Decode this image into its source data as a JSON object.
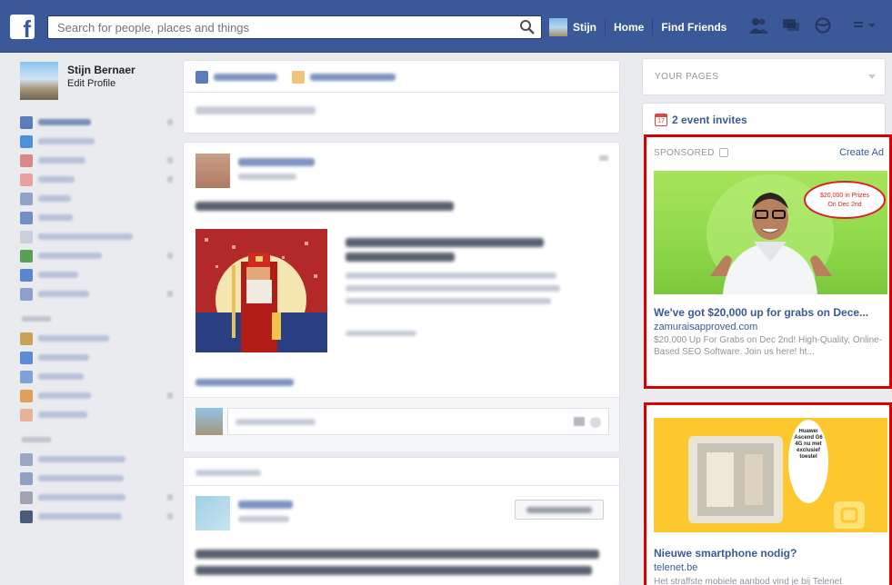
{
  "topbar": {
    "logo": "f",
    "search_placeholder": "Search for people, places and things",
    "user_name": "Stijn",
    "home_label": "Home",
    "find_friends_label": "Find Friends",
    "brand_color": "#3b5998"
  },
  "profile": {
    "name": "Stijn Bernaer",
    "edit_label": "Edit Profile"
  },
  "right": {
    "pages_label": "YOUR PAGES",
    "calendar_day": "17",
    "events_label": "2 event invites"
  },
  "ad1": {
    "sponsored_label": "SPONSORED",
    "create_ad_label": "Create Ad",
    "bubble_text_line1": "$20,000 in Prizes",
    "bubble_text_line2": "On Dec 2nd",
    "title": "We've got $20,000 up for grabs on Dece...",
    "domain": "zamuraisapproved.com",
    "desc": "$20,000 Up For Grabs on Dec 2nd! High-Quality, Online-Based SEO Software. Join us here! ht..."
  },
  "ad2": {
    "promo_text": "Huawei Ascend G6 4G nu met exclusief toestel",
    "title": "Nieuwe smartphone nodig?",
    "domain": "telenet.be",
    "desc": "Het straffste mobiele aanbod vind je bij Telenet",
    "highlight_color": "#d90000"
  }
}
